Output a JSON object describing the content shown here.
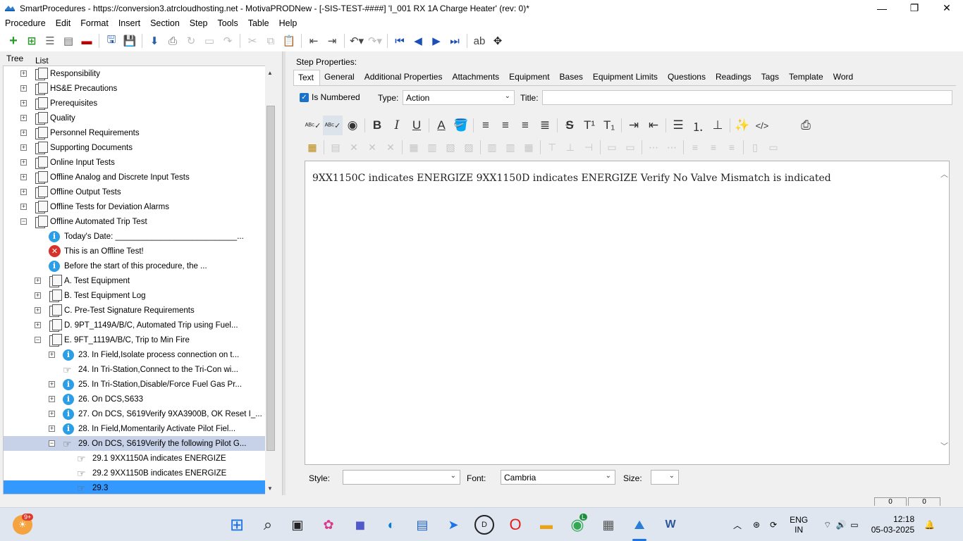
{
  "window": {
    "title": "SmartProcedures - https://conversion3.atrcloudhosting.net - MotivaPRODNew - [-SIS-TEST-####] 'I_001 RX 1A Charge Heater' (rev: 0)*",
    "minimize": "—",
    "maximize": "❐",
    "close": "✕"
  },
  "menu": [
    "Procedure",
    "Edit",
    "Format",
    "Insert",
    "Section",
    "Step",
    "Tools",
    "Table",
    "Help"
  ],
  "left_tabs": {
    "tree": "Tree",
    "list": "List"
  },
  "tree": [
    {
      "label": "Responsibility",
      "icon": "document-icon",
      "expander": "+",
      "level": 1
    },
    {
      "label": "HS&E Precautions",
      "icon": "document-icon",
      "expander": "+",
      "level": 1
    },
    {
      "label": "Prerequisites",
      "icon": "document-icon",
      "expander": "+",
      "level": 1
    },
    {
      "label": "Quality",
      "icon": "document-icon",
      "expander": "+",
      "level": 1
    },
    {
      "label": "Personnel Requirements",
      "icon": "document-icon",
      "expander": "+",
      "level": 1
    },
    {
      "label": "Supporting Documents",
      "icon": "document-icon",
      "expander": "+",
      "level": 1
    },
    {
      "label": "Online Input Tests",
      "icon": "document-icon",
      "expander": "+",
      "level": 1
    },
    {
      "label": "Offline Analog and Discrete Input Tests",
      "icon": "document-icon",
      "expander": "+",
      "level": 1
    },
    {
      "label": "Offline Output Tests",
      "icon": "document-icon",
      "expander": "+",
      "level": 1
    },
    {
      "label": "Offline Tests for Deviation Alarms",
      "icon": "document-icon",
      "expander": "+",
      "level": 1
    },
    {
      "label": "Offline Automated Trip Test",
      "icon": "document-icon",
      "expander": "−",
      "level": 1
    },
    {
      "label": "Today's Date: ___________________________...",
      "icon": "info-icon",
      "expander": "",
      "level": 2
    },
    {
      "label": "This is an Offline Test!",
      "icon": "error-icon",
      "expander": "",
      "level": 2
    },
    {
      "label": "Before the start of this procedure, the ...",
      "icon": "info-icon",
      "expander": "",
      "level": 2
    },
    {
      "label": "A. Test Equipment",
      "icon": "document-icon",
      "expander": "+",
      "level": 2
    },
    {
      "label": "B. Test Equipment Log",
      "icon": "document-icon",
      "expander": "+",
      "level": 2
    },
    {
      "label": "C. Pre-Test Signature Requirements",
      "icon": "document-icon",
      "expander": "+",
      "level": 2
    },
    {
      "label": "D. 9PT_1149A/B/C, Automated Trip using Fuel...",
      "icon": "document-icon",
      "expander": "+",
      "level": 2
    },
    {
      "label": "E. 9FT_1119A/B/C, Trip to Min Fire",
      "icon": "document-icon",
      "expander": "−",
      "level": 2
    },
    {
      "label": "23. In Field,Isolate process connection on t...",
      "icon": "info-icon",
      "expander": "+",
      "level": 3
    },
    {
      "label": "24. In Tri-Station,Connect to the Tri-Con wi...",
      "icon": "hand-icon",
      "expander": "",
      "level": 3
    },
    {
      "label": "25. In Tri-Station,Disable/Force Fuel Gas Pr...",
      "icon": "info-icon",
      "expander": "+",
      "level": 3
    },
    {
      "label": "26. On DCS,S633",
      "icon": "info-icon",
      "expander": "+",
      "level": 3
    },
    {
      "label": "27. On DCS, S619Verify 9XA3900B, OK Reset I_...",
      "icon": "info-icon",
      "expander": "+",
      "level": 3
    },
    {
      "label": "28. In Field,Momentarily Activate Pilot Fiel...",
      "icon": "info-icon",
      "expander": "+",
      "level": 3
    },
    {
      "label": "29. On DCS, S619Verify the following Pilot G...",
      "icon": "hand-icon",
      "expander": "−",
      "level": 3,
      "selected": "gray"
    },
    {
      "label": "29.1 9XX1150A indicates ENERGIZE",
      "icon": "hand-icon",
      "expander": "",
      "level": 4
    },
    {
      "label": "29.2 9XX1150B indicates ENERGIZE",
      "icon": "hand-icon",
      "expander": "",
      "level": 4
    },
    {
      "label": "29.3",
      "icon": "hand-icon",
      "expander": "",
      "level": 4,
      "selected": "blue"
    }
  ],
  "step_properties": {
    "heading": "Step Properties:",
    "tabs": [
      "Text",
      "General",
      "Additional Properties",
      "Attachments",
      "Equipment",
      "Bases",
      "Equipment Limits",
      "Questions",
      "Readings",
      "Tags",
      "Template",
      "Word"
    ],
    "active_tab": "Text",
    "is_numbered_label": "Is Numbered",
    "is_numbered": true,
    "type_label": "Type:",
    "type_value": "Action",
    "title_label": "Title:",
    "title_value": "",
    "editor_text": "9XX1150C indicates ENERGIZE 9XX1150D indicates ENERGIZE Verify No Valve Mismatch is indicated",
    "style_label": "Style:",
    "style_value": "",
    "font_label": "Font:",
    "font_value": "Cambria",
    "size_label": "Size:",
    "size_value": ""
  },
  "status": {
    "left_value": "0",
    "right_value": "0"
  },
  "taskbar": {
    "notification_badge": "9+",
    "chrome_badge": "L",
    "lang_line1": "ENG",
    "lang_line2": "IN",
    "time": "12:18",
    "date": "05-03-2025"
  },
  "colors": {
    "selection_blue": "#3399ff",
    "selection_gray": "#c7d2e8",
    "info_blue": "#2c9ee6",
    "error_red": "#d6322a"
  }
}
